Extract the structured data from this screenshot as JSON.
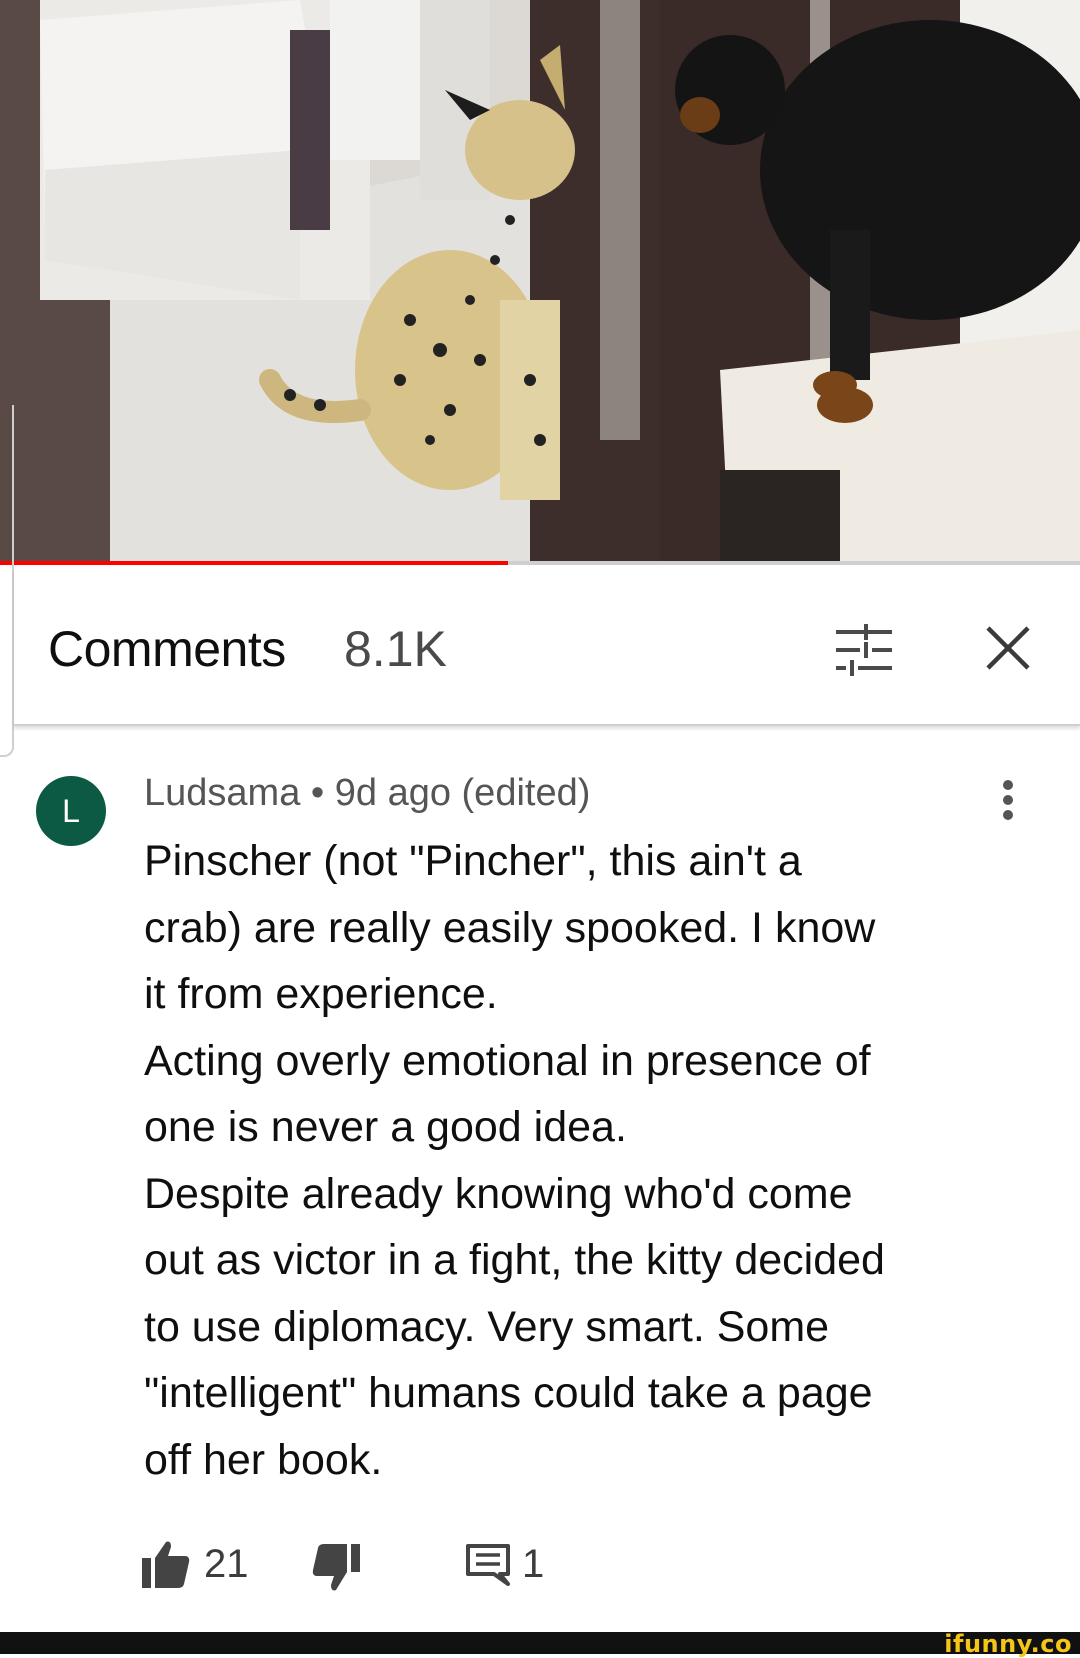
{
  "video": {
    "progress_percent": 47,
    "accent_color": "#ff0000"
  },
  "comments_header": {
    "title": "Comments",
    "count": "8.1K",
    "sort_icon": "sort-sliders-icon",
    "close_icon": "close-icon"
  },
  "comment": {
    "avatar_letter": "L",
    "avatar_color": "#0c5a43",
    "meta": "Ludsama • 9d ago (edited)",
    "lines": [
      "Pinscher (not \"Pincher\", this ain't a",
      "crab) are really easily spooked. I know",
      "it from experience.",
      "Acting overly emotional in presence of",
      "one is never a good idea.",
      "Despite already knowing who'd come",
      "out as victor in a fight, the kitty decided",
      "to use diplomacy. Very smart. Some",
      "\"intelligent\" humans could take a page",
      "off her book."
    ],
    "likes": "21",
    "replies": "1",
    "more_icon": "more-vertical-icon"
  },
  "watermark": "ifunny.co"
}
